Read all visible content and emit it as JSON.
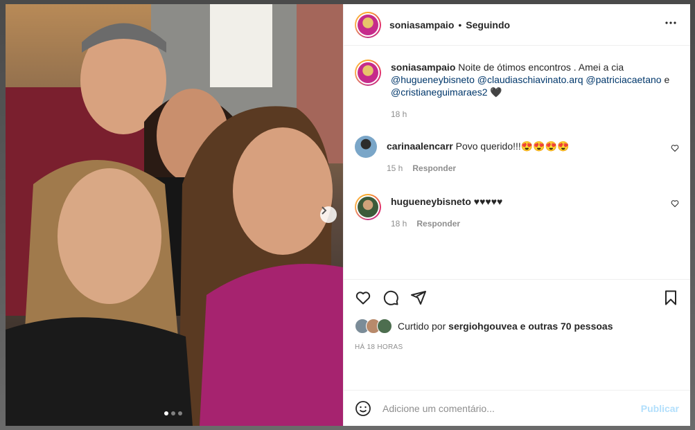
{
  "post": {
    "username": "soniasampaio",
    "separator": "•",
    "follow_status": "Seguindo",
    "more_icon": "more-horizontal-icon"
  },
  "caption": {
    "username": "soniasampaio",
    "text": "Noite de ótimos encontros . Amei a cia",
    "mentions": [
      "@huguenеybisneto",
      "@claudiaschiavinato.arq",
      "@patriciacaetano",
      "@cristianeguimaraes2"
    ],
    "conjunction": "e",
    "trailing_emoji": "🖤",
    "time": "18 h"
  },
  "comments": [
    {
      "username": "carinaalencarr",
      "text": "Povo querido!!!😍😍😍😍",
      "time": "15 h",
      "reply_label": "Responder"
    },
    {
      "username": "hugueneybisneto",
      "text": "♥♥♥♥♥",
      "time": "18 h",
      "reply_label": "Responder"
    }
  ],
  "likes": {
    "prefix": "Curtido por",
    "user": "sergiohgouvea",
    "suffix": "e outras 70 pessoas"
  },
  "timestamp": "HÁ 18 HORAS",
  "add_comment": {
    "placeholder": "Adicione um comentário...",
    "publish_label": "Publicar"
  },
  "carousel": {
    "total": 3,
    "active_index": 0
  },
  "colors": {
    "link": "#00376b",
    "muted": "#8e8e8e",
    "publish": "#b2dffc"
  }
}
